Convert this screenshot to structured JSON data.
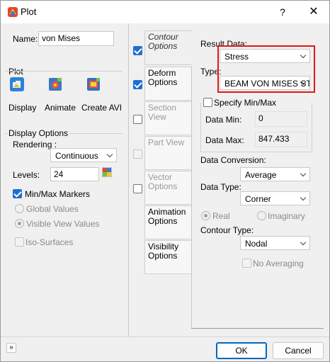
{
  "window": {
    "title": "Plot",
    "help_label": "?",
    "close_label": "✕"
  },
  "left": {
    "name_label": "Name:",
    "name_value": "von Mises",
    "plot_label": "Plot",
    "display_label": "Display",
    "animate_label": "Animate",
    "create_avi_label": "Create AVI",
    "display_options_label": "Display Options",
    "rendering_label": "Rendering :",
    "rendering_value": "Continuous",
    "levels_label": "Levels:",
    "levels_value": "24",
    "minmax_label": "Min/Max Markers",
    "global_values_label": "Global Values",
    "visible_view_values_label": "Visible View Values",
    "iso_surfaces_label": "Iso-Surfaces"
  },
  "tabs": [
    {
      "label_1": "Contour",
      "label_2": "Options"
    },
    {
      "label_1": "Deform",
      "label_2": "Options"
    },
    {
      "label_1": "Section View"
    },
    {
      "label_1": "Part View"
    },
    {
      "label_1": "Vector",
      "label_2": "Options"
    },
    {
      "label_1": "Animation",
      "label_2": "Options"
    },
    {
      "label_1": "Visibility",
      "label_2": "Options"
    }
  ],
  "contour": {
    "result_data_label": "Result Data:",
    "result_data_value": "Stress",
    "type_label": "Type:",
    "type_value": "BEAM VON MISES STRI",
    "specify_minmax_label": "Specify Min/Max",
    "data_min_label": "Data Min:",
    "data_min_value": "0",
    "data_max_label": "Data Max:",
    "data_max_value": "847.433",
    "data_conversion_label": "Data Conversion:",
    "data_conversion_value": "Average",
    "data_type_label": "Data Type:",
    "data_type_value": "Corner",
    "real_label": "Real",
    "imaginary_label": "Imaginary",
    "contour_type_label": "Contour Type:",
    "contour_type_value": "Nodal",
    "no_averaging_label": "No Averaging"
  },
  "footer": {
    "ok_label": "OK",
    "cancel_label": "Cancel",
    "expand_label": "»"
  },
  "colors": {
    "accent": "#1f6fd1",
    "highlight": "#e01919"
  }
}
